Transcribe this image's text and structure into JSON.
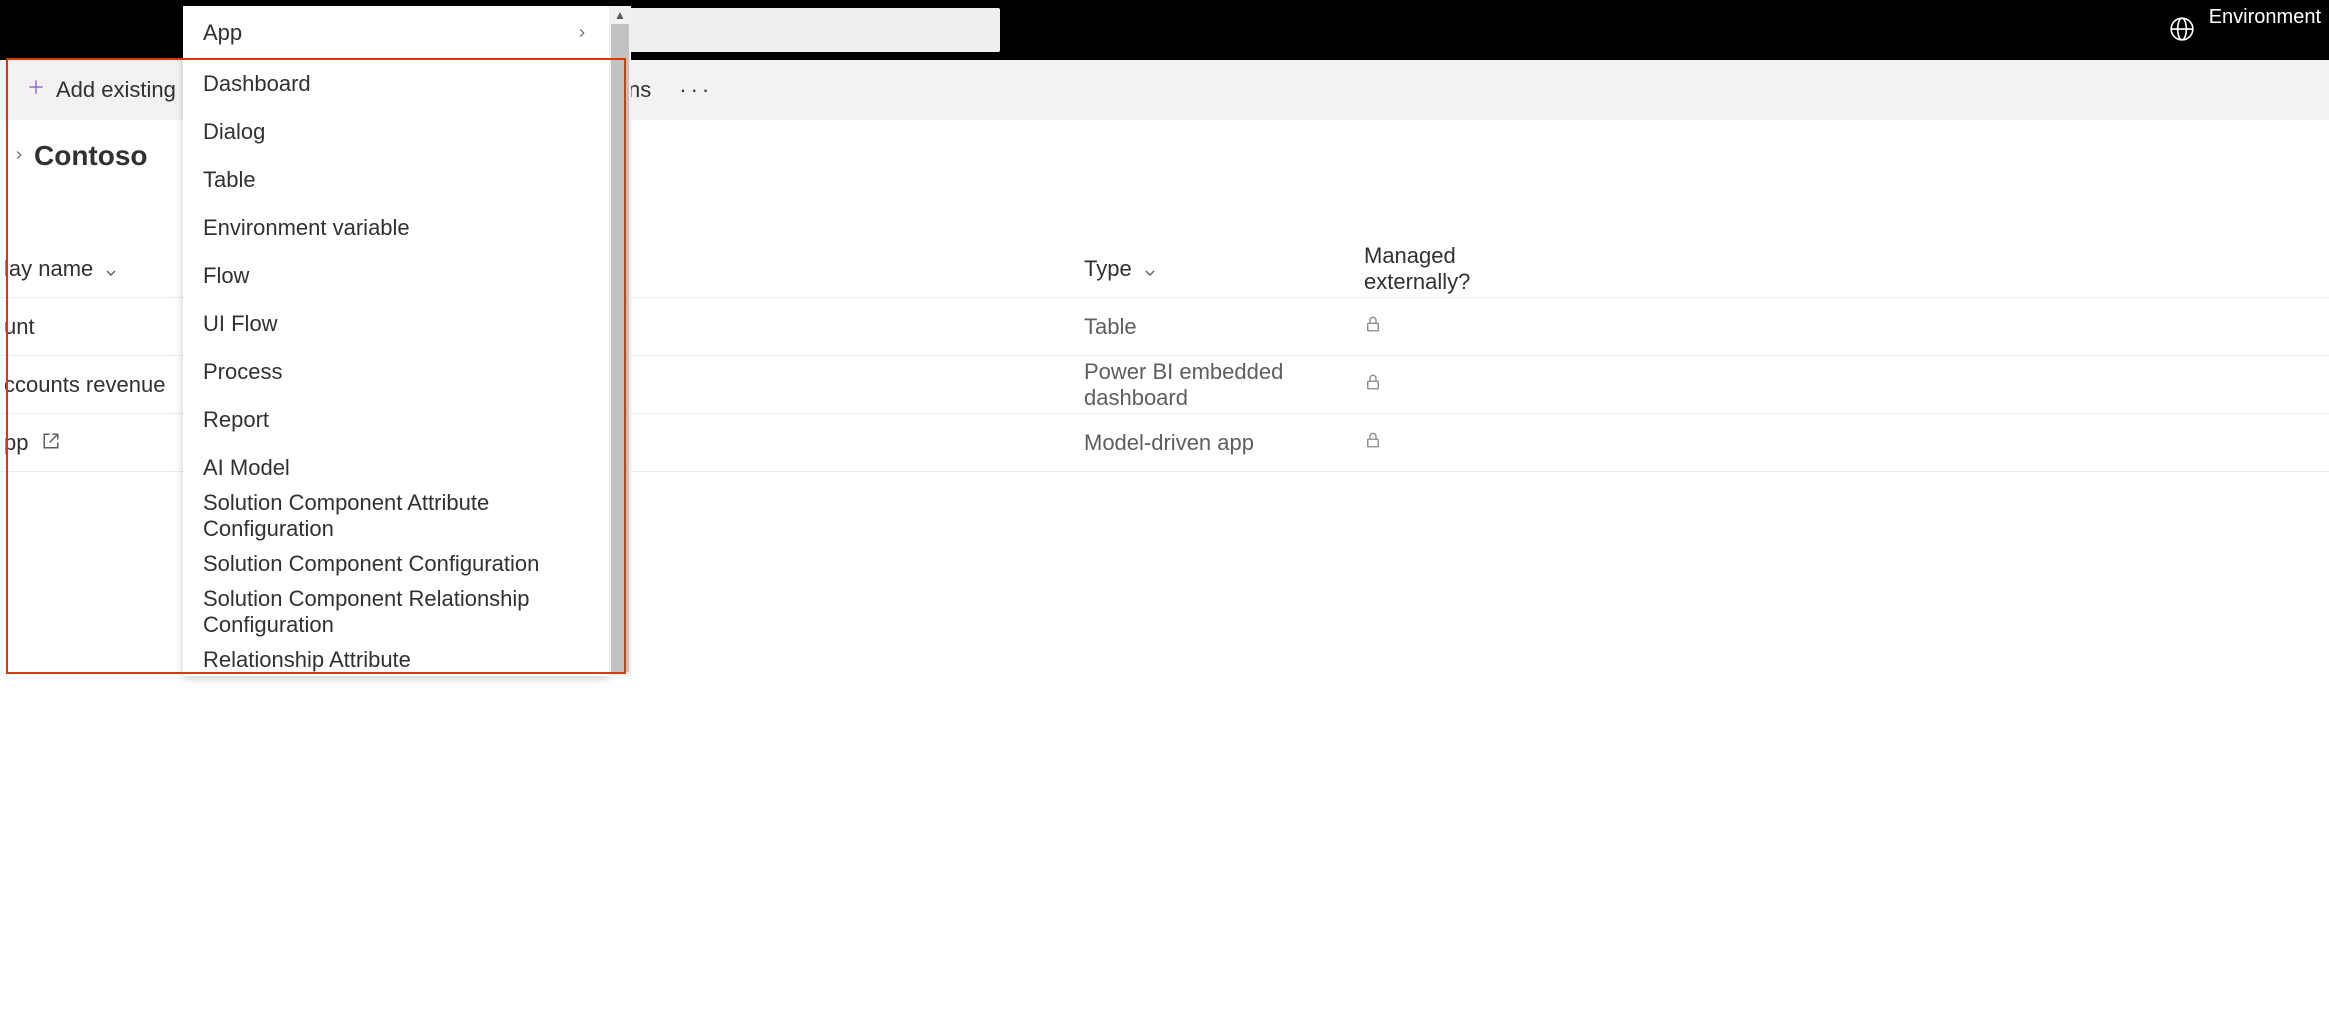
{
  "topbar": {
    "env_label": "Environment"
  },
  "cmdbar": {
    "add_existing_label": "Add existing",
    "right_fragment": "ns"
  },
  "breadcrumb": {
    "title": "Contoso"
  },
  "table": {
    "headers": {
      "display_name": "lay name",
      "name2": "",
      "type": "Type",
      "managed": "Managed externally?"
    },
    "rows": [
      {
        "display_name": "unt",
        "name2": "",
        "type": "Table",
        "link_icon": false
      },
      {
        "display_name": "ccounts revenue",
        "name2": "ts revenue",
        "type": "Power BI embedded dashboard",
        "link_icon": false
      },
      {
        "display_name": "pp",
        "name2": "pp",
        "type": "Model-driven app",
        "link_icon": true
      }
    ]
  },
  "dropdown": {
    "items": [
      {
        "label": "App",
        "has_submenu": true
      },
      {
        "label": "Dashboard",
        "has_submenu": false
      },
      {
        "label": "Dialog",
        "has_submenu": false
      },
      {
        "label": "Table",
        "has_submenu": false
      },
      {
        "label": "Environment variable",
        "has_submenu": false
      },
      {
        "label": "Flow",
        "has_submenu": false
      },
      {
        "label": "UI Flow",
        "has_submenu": false
      },
      {
        "label": "Process",
        "has_submenu": false
      },
      {
        "label": "Report",
        "has_submenu": false
      },
      {
        "label": "AI Model",
        "has_submenu": false
      },
      {
        "label": "Solution Component Attribute Configuration",
        "has_submenu": false
      },
      {
        "label": "Solution Component Configuration",
        "has_submenu": false
      },
      {
        "label": "Solution Component Relationship Configuration",
        "has_submenu": false
      },
      {
        "label": "Relationship Attribute",
        "has_submenu": false
      }
    ]
  }
}
